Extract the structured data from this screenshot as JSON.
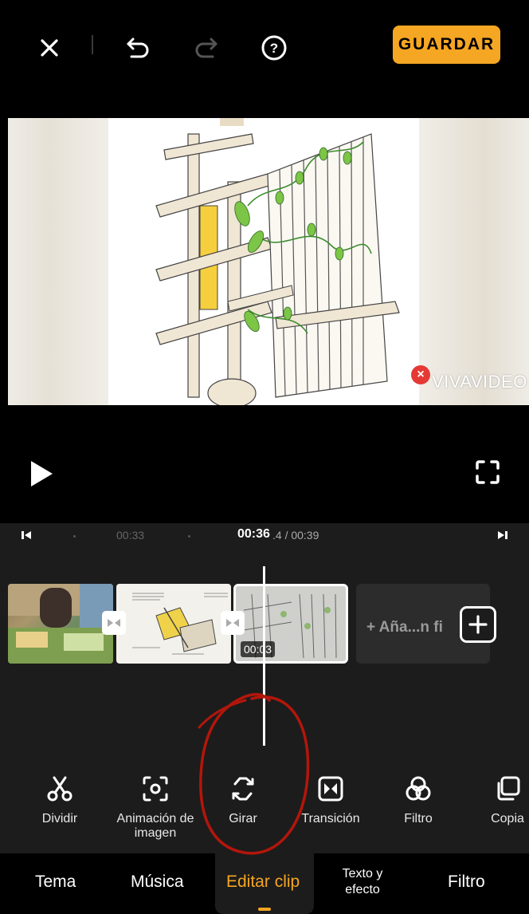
{
  "header": {
    "close_icon": "close-icon",
    "undo_icon": "undo-icon",
    "redo_icon": "redo-icon",
    "help_icon": "help-icon",
    "save_label": "GUARDAR"
  },
  "preview": {
    "watermark_text": "VIVAVIDEO"
  },
  "player": {
    "play_icon": "play-icon",
    "fullscreen_icon": "fullscreen-icon"
  },
  "timeline": {
    "tick_label": "00:33",
    "current_time": "00:36",
    "total_time": ".4 / 00:39",
    "selected_clip_duration": "00:03",
    "add_clip_label": "+ Aña...n fi"
  },
  "tools": [
    {
      "label": "Dividir",
      "icon": "scissors-icon"
    },
    {
      "label": "Animación de imagen",
      "icon": "image-animation-icon"
    },
    {
      "label": "Girar",
      "icon": "rotate-icon"
    },
    {
      "label": "Transición",
      "icon": "transition-icon"
    },
    {
      "label": "Filtro",
      "icon": "filter-icon"
    },
    {
      "label": "Copia",
      "icon": "copy-icon"
    }
  ],
  "bottom_nav": {
    "tabs": [
      "Tema",
      "Música",
      "Editar clip",
      "Texto y efecto",
      "Filtro"
    ],
    "active": "Editar clip"
  },
  "colors": {
    "accent": "#f5a623",
    "background": "#000000",
    "panel": "#1c1c1c",
    "annotation": "#b3160b"
  }
}
